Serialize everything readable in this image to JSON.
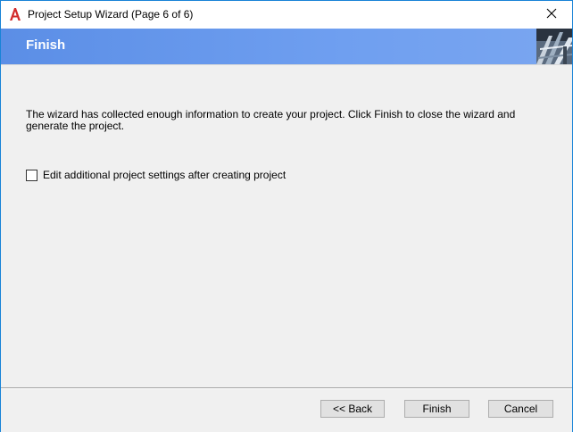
{
  "window": {
    "title": "Project Setup Wizard (Page 6 of 6)",
    "app_icon": "autocad-a-icon",
    "close_icon": "close-icon"
  },
  "banner": {
    "title": "Finish",
    "image": "structure-photo-thumbnail"
  },
  "content": {
    "description": "The wizard has collected enough information to create your project. Click Finish to close the wizard and generate the project.",
    "checkbox": {
      "label": "Edit additional project settings after creating project",
      "checked": false
    }
  },
  "footer": {
    "back_label": "<< Back",
    "finish_label": "Finish",
    "cancel_label": "Cancel"
  },
  "colors": {
    "banner": "#6d9eeb",
    "window_border": "#1883d7",
    "app_icon_red": "#d22b2b"
  }
}
